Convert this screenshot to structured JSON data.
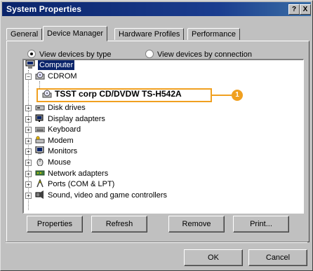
{
  "window": {
    "title": "System Properties",
    "help_label": "?",
    "close_label": "X"
  },
  "tabs": [
    {
      "label": "General",
      "active": false
    },
    {
      "label": "Device Manager",
      "active": true
    },
    {
      "label": "Hardware Profiles",
      "active": false
    },
    {
      "label": "Performance",
      "active": false
    }
  ],
  "view_options": {
    "by_type": "View devices by type",
    "by_connection": "View devices by connection",
    "selected": "by_type"
  },
  "tree": {
    "root": "Computer",
    "cdrom": "CDROM",
    "cdrom_device": "TSST corp CD/DVDW TS-H542A",
    "items": [
      {
        "label": "Disk drives",
        "icon": "disk-drive-icon"
      },
      {
        "label": "Display adapters",
        "icon": "display-adapter-icon"
      },
      {
        "label": "Keyboard",
        "icon": "keyboard-icon"
      },
      {
        "label": "Modem",
        "icon": "modem-icon"
      },
      {
        "label": "Monitors",
        "icon": "monitor-icon"
      },
      {
        "label": "Mouse",
        "icon": "mouse-icon"
      },
      {
        "label": "Network adapters",
        "icon": "network-adapter-icon"
      },
      {
        "label": "Ports (COM & LPT)",
        "icon": "ports-icon"
      },
      {
        "label": "Sound, video and game controllers",
        "icon": "sound-icon"
      }
    ]
  },
  "callout": {
    "number": "1",
    "color": "#f0a020"
  },
  "buttons": {
    "properties": "Properties",
    "refresh": "Refresh",
    "remove": "Remove",
    "print": "Print...",
    "ok": "OK",
    "cancel": "Cancel"
  },
  "colors": {
    "titlebar": "#0a246a",
    "face": "#c0c0c0",
    "selection": "#0a246a"
  }
}
